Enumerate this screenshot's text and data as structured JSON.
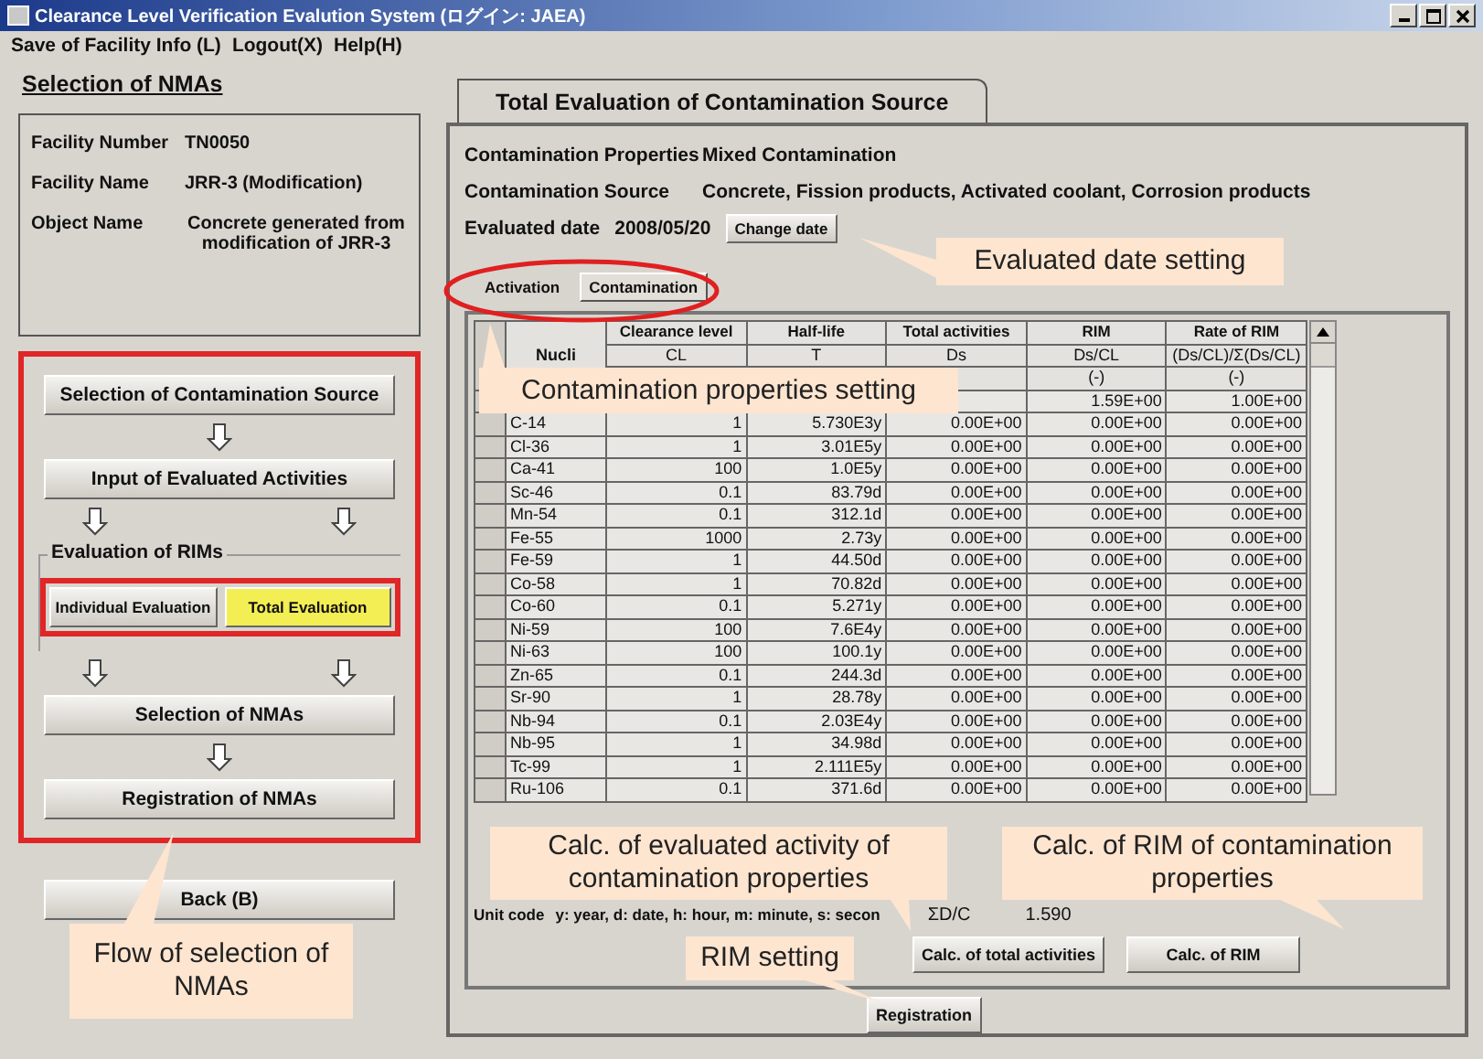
{
  "window": {
    "title": "Clearance Level Verification Evalution System (ログイン: JAEA)"
  },
  "menu": [
    {
      "label": "Save of Facility Info (L)"
    },
    {
      "label": "Logout(X)"
    },
    {
      "label": "Help(H)"
    }
  ],
  "left": {
    "heading": "Selection of NMAs",
    "info": [
      {
        "label": "Facility Number",
        "value": "TN0050"
      },
      {
        "label": "Facility Name",
        "value": "JRR-3 (Modification)"
      },
      {
        "label": "Object Name",
        "value": "Concrete generated from modification of JRR-3"
      }
    ],
    "steps": [
      "Selection of Contamination Source",
      "Input of Evaluated Activities",
      "Selection of NMAs",
      "Registration of NMAs"
    ],
    "evaluation_group": "Evaluation of RIMs",
    "evaluations": [
      {
        "label": "Individual Evaluation",
        "selected": false
      },
      {
        "label": "Total Evaluation",
        "selected": true
      }
    ],
    "back_button": "Back (B)"
  },
  "right": {
    "tab": "Total Evaluation of Contamination Source",
    "properties": [
      {
        "label": "Contamination Properties",
        "value": "Mixed Contamination"
      },
      {
        "label": "Contamination Source",
        "value": "Concrete, Fission products, Activated coolant, Corrosion products"
      }
    ],
    "date_label": "Evaluated date",
    "date_value": "2008/05/20",
    "change_date_button": "Change date",
    "subtabs": [
      {
        "label": "Activation",
        "selected": false
      },
      {
        "label": "Contamination",
        "selected": true
      }
    ],
    "table": {
      "nuclide_header": "Nucli",
      "header_row_1": [
        "Clearance level",
        "Half-life",
        "Total activities",
        "RIM",
        "Rate of RIM"
      ],
      "header_row_2": [
        "CL",
        "T",
        "Ds",
        "Ds/CL",
        "(Ds/CL)/Σ(Ds/CL)"
      ],
      "header_row_3": [
        "(-)",
        "(-)"
      ],
      "rows": [
        [
          null,
          null,
          null,
          null,
          "1.59E+00",
          "1.00E+00"
        ],
        [
          "C-14",
          "1",
          "5.730E3y",
          "0.00E+00",
          "0.00E+00",
          "0.00E+00"
        ],
        [
          "Cl-36",
          "1",
          "3.01E5y",
          "0.00E+00",
          "0.00E+00",
          "0.00E+00"
        ],
        [
          "Ca-41",
          "100",
          "1.0E5y",
          "0.00E+00",
          "0.00E+00",
          "0.00E+00"
        ],
        [
          "Sc-46",
          "0.1",
          "83.79d",
          "0.00E+00",
          "0.00E+00",
          "0.00E+00"
        ],
        [
          "Mn-54",
          "0.1",
          "312.1d",
          "0.00E+00",
          "0.00E+00",
          "0.00E+00"
        ],
        [
          "Fe-55",
          "1000",
          "2.73y",
          "0.00E+00",
          "0.00E+00",
          "0.00E+00"
        ],
        [
          "Fe-59",
          "1",
          "44.50d",
          "0.00E+00",
          "0.00E+00",
          "0.00E+00"
        ],
        [
          "Co-58",
          "1",
          "70.82d",
          "0.00E+00",
          "0.00E+00",
          "0.00E+00"
        ],
        [
          "Co-60",
          "0.1",
          "5.271y",
          "0.00E+00",
          "0.00E+00",
          "0.00E+00"
        ],
        [
          "Ni-59",
          "100",
          "7.6E4y",
          "0.00E+00",
          "0.00E+00",
          "0.00E+00"
        ],
        [
          "Ni-63",
          "100",
          "100.1y",
          "0.00E+00",
          "0.00E+00",
          "0.00E+00"
        ],
        [
          "Zn-65",
          "0.1",
          "244.3d",
          "0.00E+00",
          "0.00E+00",
          "0.00E+00"
        ],
        [
          "Sr-90",
          "1",
          "28.78y",
          "0.00E+00",
          "0.00E+00",
          "0.00E+00"
        ],
        [
          "Nb-94",
          "0.1",
          "2.03E4y",
          "0.00E+00",
          "0.00E+00",
          "0.00E+00"
        ],
        [
          "Nb-95",
          "1",
          "34.98d",
          "0.00E+00",
          "0.00E+00",
          "0.00E+00"
        ],
        [
          "Tc-99",
          "1",
          "2.111E5y",
          "0.00E+00",
          "0.00E+00",
          "0.00E+00"
        ],
        [
          "Ru-106",
          "0.1",
          "371.6d",
          "0.00E+00",
          "0.00E+00",
          "0.00E+00"
        ]
      ]
    },
    "unit_code_label": "Unit code",
    "unit_code_text": "y: year, d: date, h: hour, m: minute, s: secon",
    "sum_label": "ΣD/C",
    "sum_value": "1.590",
    "calc_buttons": [
      "Calc. of total activities",
      "Calc. of RIM"
    ],
    "registration_button": "Registration"
  },
  "annotations": [
    {
      "text": "Evaluated date setting"
    },
    {
      "text": "Contamination properties setting"
    },
    {
      "text": "Calc. of evaluated activity of contamination properties"
    },
    {
      "text": "Calc. of RIM of contamination properties"
    },
    {
      "text": "RIM setting"
    },
    {
      "text": "Flow of selection of NMAs"
    }
  ]
}
